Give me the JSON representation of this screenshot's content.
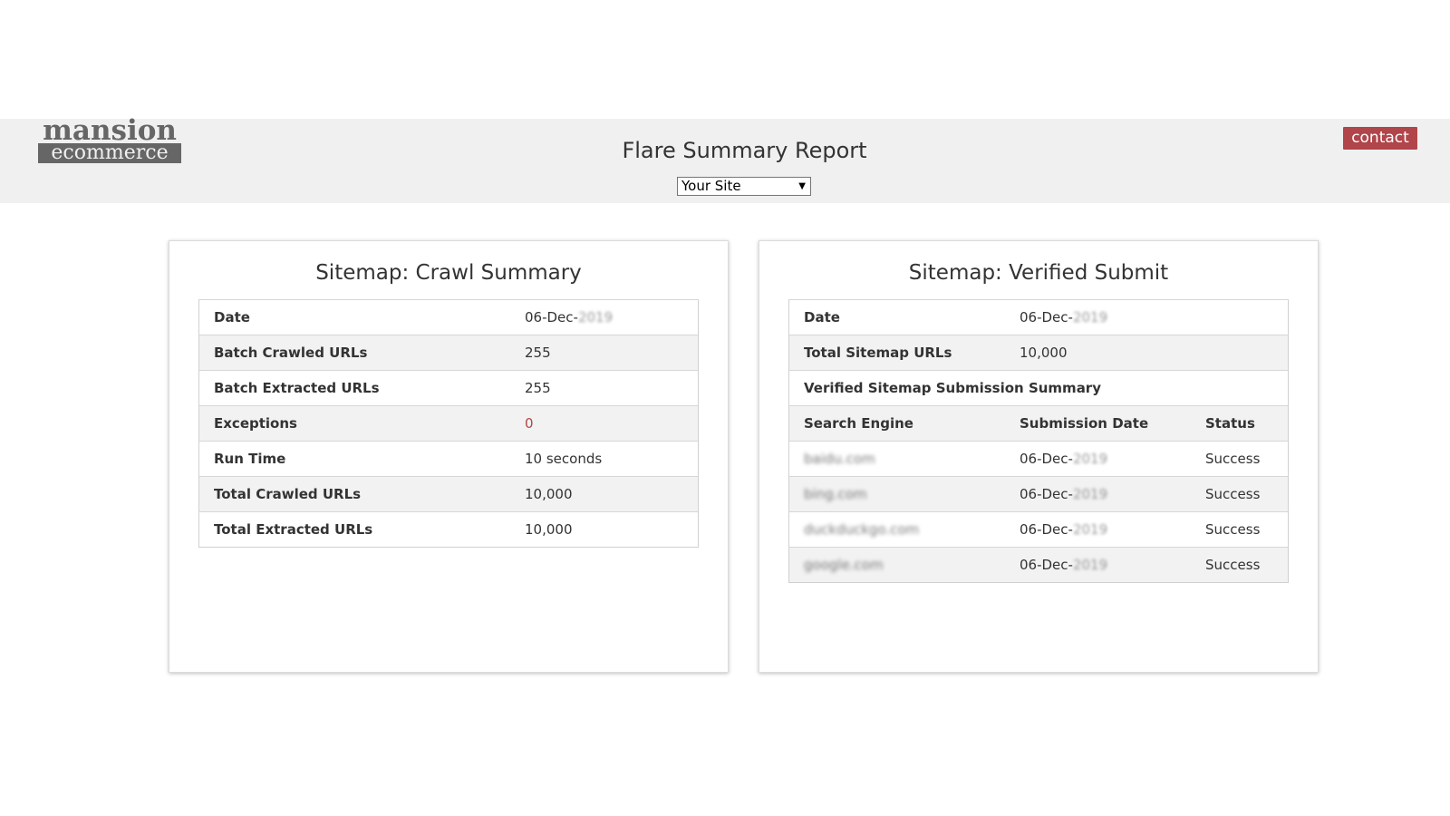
{
  "header": {
    "logo_top": "mansion",
    "logo_bottom": "ecommerce",
    "title": "Flare Summary Report",
    "site_select": "Your Site",
    "contact": "contact"
  },
  "crawl": {
    "title": "Sitemap: Crawl Summary",
    "rows": [
      {
        "label": "Date",
        "value": "06-Dec-",
        "blur": "2019"
      },
      {
        "label": "Batch Crawled URLs",
        "value": "255"
      },
      {
        "label": "Batch Extracted URLs",
        "value": "255"
      },
      {
        "label": "Exceptions",
        "value": "0"
      },
      {
        "label": "Run Time",
        "value": "10 seconds"
      },
      {
        "label": "Total Crawled URLs",
        "value": "10,000"
      },
      {
        "label": "Total Extracted URLs",
        "value": "10,000"
      }
    ]
  },
  "verified": {
    "title": "Sitemap: Verified Submit",
    "date_label": "Date",
    "date_value": "06-Dec-",
    "date_blur": "2019",
    "total_label": "Total Sitemap URLs",
    "total_value": "10,000",
    "section_title": "Verified Sitemap Submission Summary",
    "columns": [
      "Search Engine",
      "Submission Date",
      "Status"
    ],
    "rows": [
      {
        "engine": "baidu.com",
        "date": "06-Dec-",
        "date_blur": "2019",
        "status": "Success"
      },
      {
        "engine": "bing.com",
        "date": "06-Dec-",
        "date_blur": "2019",
        "status": "Success"
      },
      {
        "engine": "duckduckgo.com",
        "date": "06-Dec-",
        "date_blur": "2019",
        "status": "Success"
      },
      {
        "engine": "google.com",
        "date": "06-Dec-",
        "date_blur": "2019",
        "status": "Success"
      }
    ]
  },
  "colors": {
    "header_bg": "#f0f0f0",
    "accent": "#b0454a",
    "stripe": "#f2f2f2"
  }
}
